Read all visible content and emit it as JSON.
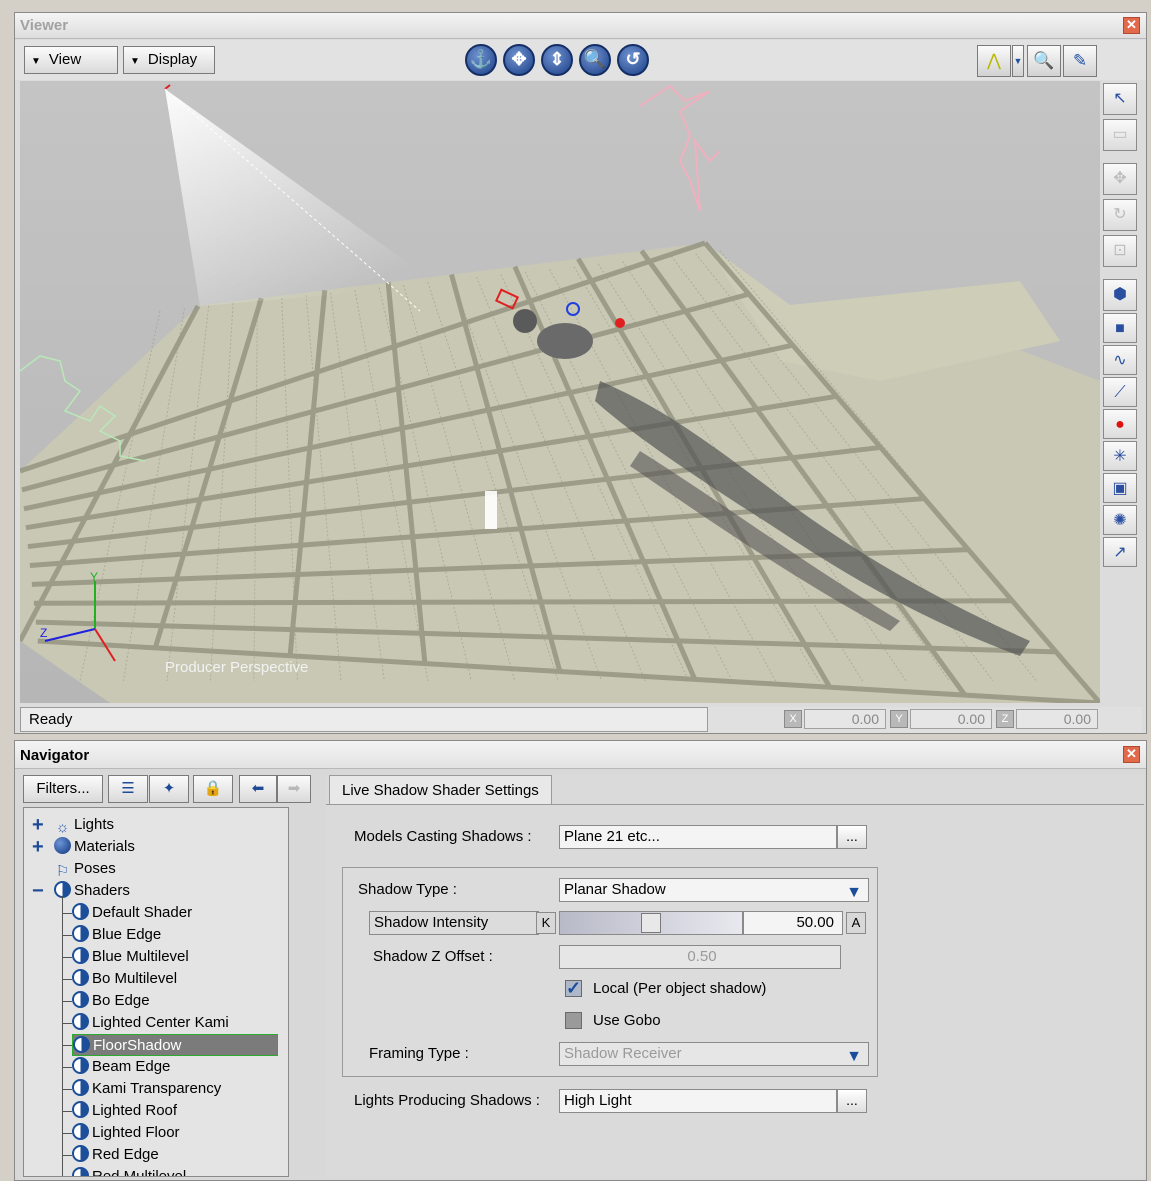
{
  "viewer": {
    "title": "Viewer",
    "close_glyph": "✕",
    "view_menu": "View",
    "display_menu": "Display",
    "nav_controls": [
      "⚓",
      "✥",
      "⇕",
      "🔍",
      "↺"
    ],
    "right_tools": [
      {
        "name": "select-arrow-icon",
        "glyph": "↖"
      },
      {
        "name": "translate-local-icon",
        "glyph": "▭"
      },
      {
        "name": "move-icon",
        "glyph": "✥"
      },
      {
        "name": "rotate-icon",
        "glyph": "↻"
      },
      {
        "name": "scale-icon",
        "glyph": "⊡"
      },
      {
        "name": "object-select-icon",
        "glyph": "⬢"
      },
      {
        "name": "cube-icon",
        "glyph": "■"
      },
      {
        "name": "curve-icon",
        "glyph": "∿"
      },
      {
        "name": "bone-icon",
        "glyph": "⟋"
      },
      {
        "name": "record-icon",
        "glyph": "●"
      },
      {
        "name": "null-icon",
        "glyph": "✳"
      },
      {
        "name": "camera-icon",
        "glyph": "▣"
      },
      {
        "name": "light-icon",
        "glyph": "✺"
      },
      {
        "name": "path-icon",
        "glyph": "↗"
      }
    ],
    "perspective_label": "Producer Perspective",
    "status": "Ready",
    "coords": {
      "x_label": "X",
      "x": "0.00",
      "y_label": "Y",
      "y": "0.00",
      "z_label": "Z",
      "z": "0.00"
    },
    "axis_labels": {
      "x": "",
      "y": "Y",
      "z": "Z"
    }
  },
  "navigator": {
    "title": "Navigator",
    "close_glyph": "✕",
    "filters_button": "Filters...",
    "tree": {
      "categories": [
        {
          "label": "Lights",
          "expander": "+"
        },
        {
          "label": "Materials",
          "expander": "+"
        },
        {
          "label": "Poses",
          "expander": ""
        },
        {
          "label": "Shaders",
          "expander": "−"
        }
      ],
      "shaders": [
        "Default Shader",
        "Blue Edge",
        "Blue Multilevel",
        "Bo Multilevel",
        "Bo Edge",
        "Lighted Center Kami",
        "FloorShadow",
        "Beam Edge",
        "Kami Transparency",
        "Lighted Roof",
        "Lighted Floor",
        "Red Edge",
        "Red Multilevel"
      ],
      "selected": "FloorShadow"
    },
    "settings": {
      "tab": "Live Shadow Shader Settings",
      "models_casting_label": "Models Casting Shadows :",
      "models_casting_value": "Plane 21 etc...",
      "shadow_type_label": "Shadow Type :",
      "shadow_type_value": "Planar Shadow",
      "shadow_intensity_label": "Shadow Intensity",
      "shadow_intensity_value": "50.00",
      "shadow_intensity_fraction": 0.5,
      "k_button": "K",
      "a_button": "A",
      "shadow_z_offset_label": "Shadow Z Offset :",
      "shadow_z_offset_value": "0.50",
      "local_label": "Local (Per object shadow)",
      "local_checked": true,
      "use_gobo_label": "Use Gobo",
      "use_gobo_checked": false,
      "framing_type_label": "Framing Type :",
      "framing_type_value": "Shadow Receiver",
      "lights_producing_label": "Lights Producing Shadows :",
      "lights_producing_value": "High Light",
      "ellipsis": "..."
    }
  },
  "colors": {
    "accent": "#1c4e9a",
    "floor": "#c8c8b4",
    "selected_border": "#2eaa2e",
    "close_red": "#e26a4a"
  }
}
